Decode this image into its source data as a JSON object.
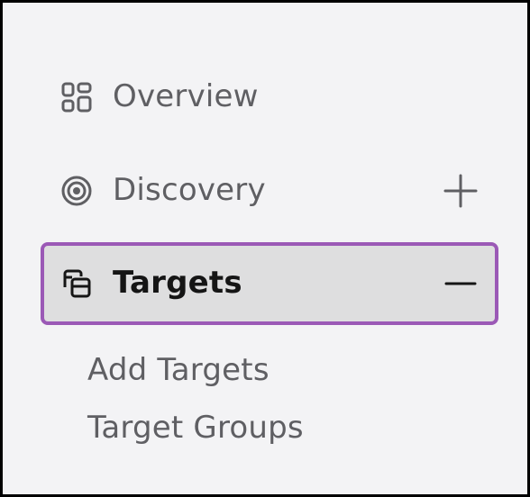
{
  "nav": {
    "items": [
      {
        "label": "Overview",
        "icon": "grid-icon",
        "toggle": null
      },
      {
        "label": "Discovery",
        "icon": "target-icon",
        "toggle": "expand-plus"
      },
      {
        "label": "Targets",
        "icon": "stacked-windows-icon",
        "toggle": "collapse-minus",
        "selected": true
      }
    ],
    "targets_subitems": [
      {
        "label": "Add Targets"
      },
      {
        "label": "Target Groups"
      }
    ]
  },
  "colors": {
    "sidebar_background": "#f3f3f5",
    "selected_background": "#dededf",
    "highlight_outline": "#9b59b6",
    "text": "#5f5f63",
    "selected_text": "#151515"
  }
}
